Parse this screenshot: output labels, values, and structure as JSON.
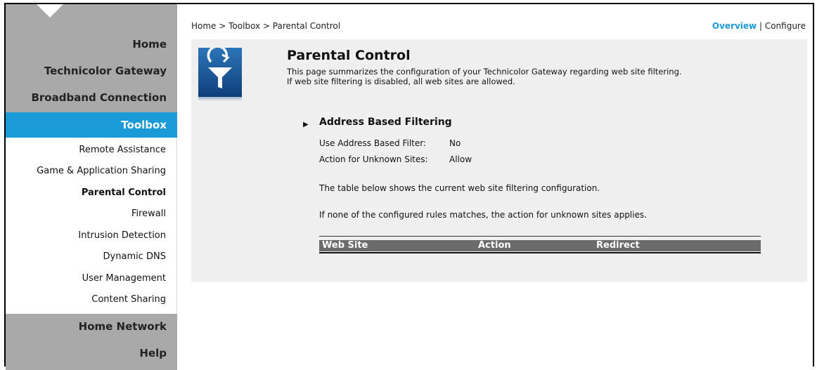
{
  "breadcrumb": "Home > Toolbox > Parental Control",
  "top_links": {
    "overview": "Overview",
    "separator": " | ",
    "configure": "Configure"
  },
  "nav": {
    "main": [
      "Home",
      "Technicolor Gateway",
      "Broadband Connection"
    ],
    "active_section": "Toolbox",
    "sub_items": [
      "Remote Assistance",
      "Game & Application Sharing",
      "Parental Control",
      "Firewall",
      "Intrusion Detection",
      "Dynamic DNS",
      "User Management",
      "Content Sharing"
    ],
    "active_sub_item": "Parental Control",
    "bottom": [
      "Home Network",
      "Help"
    ]
  },
  "page": {
    "title": "Parental Control",
    "description_1": "This page summarizes the configuration of your Technicolor Gateway regarding web site filtering.",
    "description_2": "If web site filtering is disabled, all web sites are allowed.",
    "section_title": "Address Based Filtering",
    "rows": [
      {
        "label": "Use Address Based Filter:",
        "value": "No"
      },
      {
        "label": "Action for Unknown Sites:",
        "value": "Allow"
      }
    ],
    "para_1": "The table below shows the current web site filtering configuration.",
    "para_2": "If none of the configured rules matches, the action for unknown sites applies.",
    "table_headers": [
      "Web Site",
      "Action",
      "Redirect"
    ]
  },
  "colors": {
    "accent": "#1a9ad6",
    "nav_gray": "#a9a9a9",
    "panel": "#f0f0f0",
    "table_header": "#6b6b6b"
  },
  "icons": {
    "logo": "parental-filter-icon",
    "section": "triangle-right-icon"
  }
}
